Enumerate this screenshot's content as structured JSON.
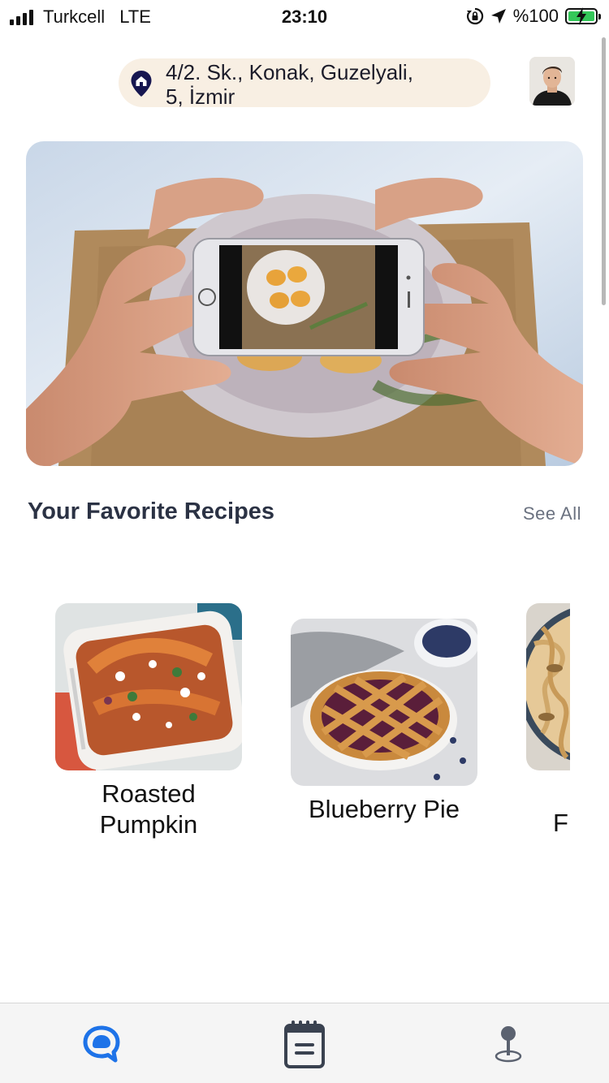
{
  "status_bar": {
    "carrier": "Turkcell",
    "network": "LTE",
    "time": "23:10",
    "battery_text": "%100",
    "battery_level": 1.0,
    "battery_color": "#34c759"
  },
  "header": {
    "address_line1": "4/2. Sk., Konak, Guzelyali,",
    "address_line2": "5, İzmir",
    "address_icon": "home-pin-icon",
    "avatar": "user-avatar"
  },
  "hero": {
    "image": "phone-photographing-food-photo"
  },
  "favorites": {
    "title": "Your Favorite Recipes",
    "see_all": "See All",
    "recipes": [
      {
        "name": "Roasted Pumpkin",
        "image": "roasted-pumpkin-photo"
      },
      {
        "name": "Blueberry Pie",
        "image": "blueberry-pie-photo"
      },
      {
        "name": "Fr",
        "image": "pasta-photo"
      }
    ]
  },
  "tab_bar": {
    "items": [
      {
        "icon": "chat-bubble-icon",
        "active": true
      },
      {
        "icon": "notepad-icon",
        "active": false
      },
      {
        "icon": "location-pin-icon",
        "active": false
      }
    ],
    "active_color": "#1e73e8",
    "inactive_color": "#3a4250"
  }
}
